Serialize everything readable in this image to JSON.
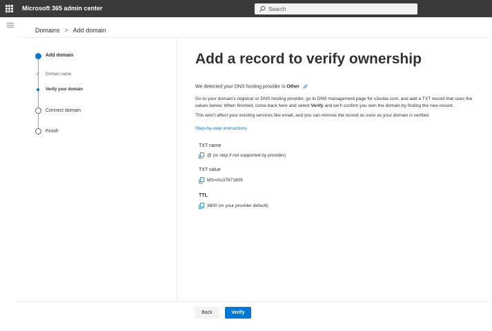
{
  "header": {
    "app_title": "Microsoft 365 admin center",
    "search_placeholder": "Search"
  },
  "breadcrumb": {
    "items": [
      "Domains",
      "Add domain"
    ],
    "separator": ">"
  },
  "stepper": {
    "steps": [
      {
        "label": "Add domain",
        "state": "current"
      },
      {
        "label": "Domain name",
        "state": "completed",
        "level": "sub"
      },
      {
        "label": "Verify your domain",
        "state": "current",
        "level": "sub"
      },
      {
        "label": "Connect domain",
        "state": "upcoming"
      },
      {
        "label": "Finish",
        "state": "upcoming"
      }
    ]
  },
  "main": {
    "heading": "Add a record to verify ownership",
    "detect_prefix": "We detected your DNS hosting provider is",
    "detect_provider": "Other",
    "para1_a": "Go to your domain's registrar or DNS hosting provider, go to DNS management page for s3solar.com, and add a TXT record that uses the values below. When finished, come back here and select",
    "para1_bold": "Verify",
    "para1_b": "and we'll confirm you own the domain by finding the new record.",
    "para2": "This won't affect your existing services like email, and you can remove the record as soon as your domain is verified.",
    "instructions_link": "Step-by-step instructions",
    "fields": [
      {
        "label": "TXT name",
        "value": "@ (or skip if not supported by provider)"
      },
      {
        "label": "TXT value",
        "value": "MS=ms37671605"
      },
      {
        "label": "TTL",
        "value": "3600 (or your provider default)"
      }
    ]
  },
  "footer": {
    "back_label": "Back",
    "verify_label": "Verify"
  },
  "colors": {
    "topbar": "#3b3a39",
    "accent": "#0078d4"
  }
}
